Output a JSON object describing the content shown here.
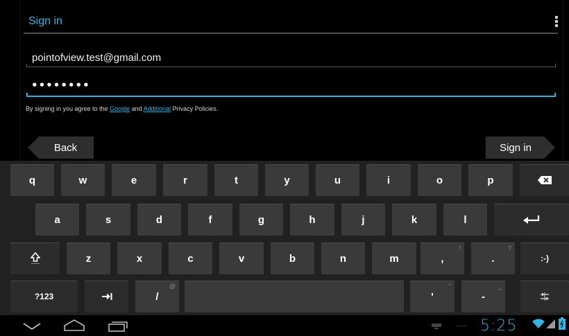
{
  "dialog": {
    "title": "Sign in",
    "email_value": "pointofview.test@gmail.com",
    "password_value": "••••••••",
    "legal_prefix": "By signing in you agree to the ",
    "legal_link_google": "Google",
    "legal_mid": " and ",
    "legal_link_additional": "Additional",
    "legal_suffix": " Privacy Policies.",
    "back_label": "Back",
    "signin_label": "Sign in"
  },
  "keyboard": {
    "row1": [
      "q",
      "w",
      "e",
      "r",
      "t",
      "y",
      "u",
      "i",
      "o",
      "p"
    ],
    "row2": [
      "a",
      "s",
      "d",
      "f",
      "g",
      "h",
      "j",
      "k",
      "l"
    ],
    "row3": [
      "z",
      "x",
      "c",
      "v",
      "b",
      "n",
      "m",
      ",",
      "."
    ],
    "row3_hints": {
      "comma": "!",
      "period": "?"
    },
    "smiley": ":-)",
    "symbols_label": "?123",
    "slash_label": "/",
    "slash_hint": "@",
    "apostrophe_label": "'",
    "apostrophe_hint": "\"",
    "dash_label": "-",
    "dash_hint": "_"
  },
  "statusbar": {
    "time": "5:25"
  },
  "icons": {
    "overflow": "overflow-menu-icon",
    "backspace": "backspace-icon",
    "enter": "enter-icon",
    "shift": "shift-icon",
    "tab": "tab-icon",
    "settings": "keyboard-settings-icon",
    "nav_back": "nav-back-icon",
    "nav_home": "nav-home-icon",
    "nav_recents": "nav-recents-icon",
    "wifi": "wifi-icon",
    "signal": "signal-icon",
    "battery": "battery-icon"
  },
  "colors": {
    "accent": "#33b5e5",
    "key_bg": "#3a3a3a",
    "keyboard_bg": "#212121"
  }
}
